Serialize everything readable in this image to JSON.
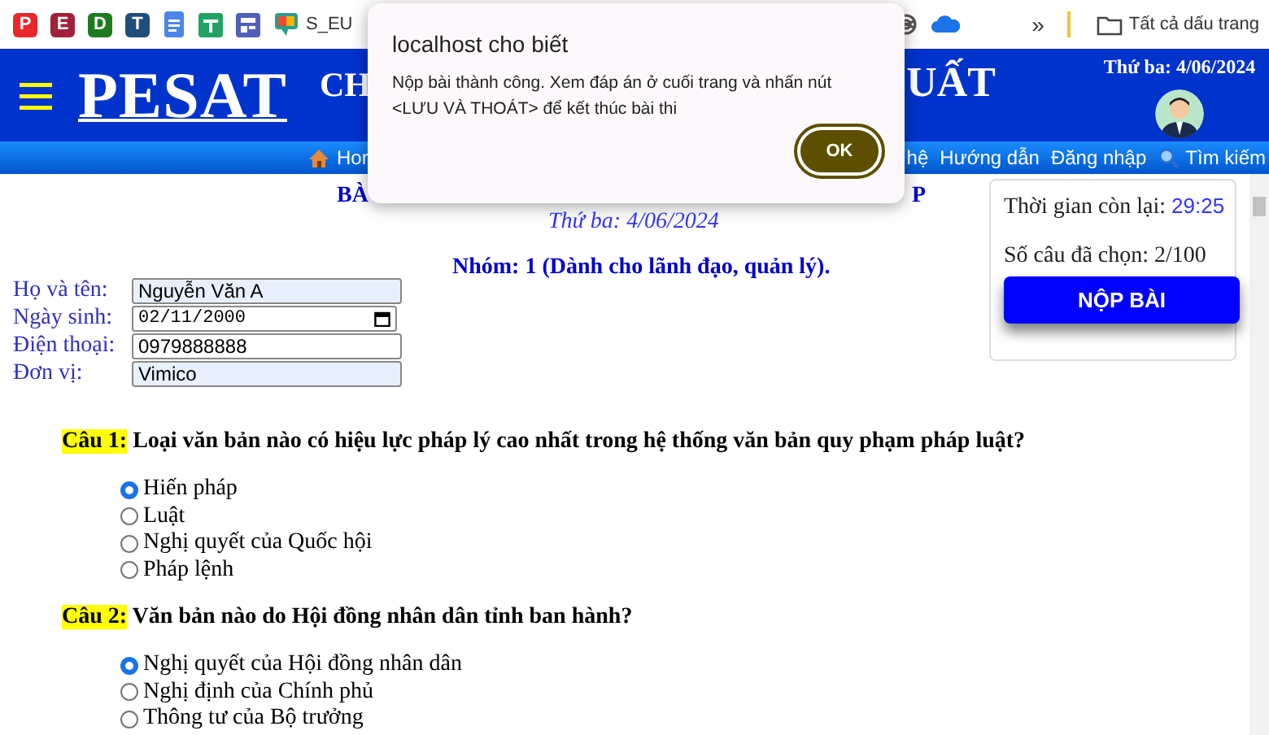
{
  "bookmarks_bar": {
    "items": [
      {
        "kind": "tile",
        "glyph": "P",
        "color": "#e8262b"
      },
      {
        "kind": "tile",
        "glyph": "E",
        "color": "#a3203a"
      },
      {
        "kind": "tile",
        "glyph": "D",
        "color": "#1e7b1e"
      },
      {
        "kind": "tile",
        "glyph": "T",
        "color": "#1f4e79"
      },
      {
        "kind": "doc",
        "color": "#4a86e8"
      },
      {
        "kind": "sheet",
        "color": "#21a366"
      },
      {
        "kind": "form",
        "color": "#5060b8"
      },
      {
        "kind": "chat",
        "color": "#2a9d8f",
        "label": "S_EU"
      }
    ],
    "right_items": [
      {
        "kind": "knot",
        "color": "#555555"
      },
      {
        "kind": "cloud",
        "color": "#1a73e8"
      }
    ],
    "overflow": "»",
    "all_bookmarks": "Tất cả dấu trang"
  },
  "header": {
    "logo": "PESAT",
    "title_fragments": [
      "CH",
      "UẤT"
    ],
    "date": "Thứ ba: 4/06/2024"
  },
  "nav": {
    "items": [
      {
        "label": "Hor",
        "kind": "home"
      },
      {
        "label": "hệ",
        "kind": "plain"
      },
      {
        "label": "Hướng dẫn",
        "kind": "plain"
      },
      {
        "label": "Đăng nhập",
        "kind": "plain"
      },
      {
        "label": "Tìm kiếm",
        "kind": "search"
      }
    ]
  },
  "exam": {
    "title_fragments": [
      "BÀ",
      "P"
    ],
    "date": "Thứ ba: 4/06/2024",
    "group": "Nhóm: 1 (Dành cho lãnh đạo, quản lý)."
  },
  "form": {
    "fields": [
      {
        "label": "Họ và tên:",
        "value": "Nguyễn Văn A",
        "kind": "text",
        "autofilled": true
      },
      {
        "label": "Ngày sinh:",
        "value": "02/11/2000",
        "kind": "date",
        "autofilled": false
      },
      {
        "label": "Điện thoại:",
        "value": "0979888888",
        "kind": "text",
        "autofilled": false
      },
      {
        "label": "Đơn vị:",
        "value": "Vimico",
        "kind": "text",
        "autofilled": true
      }
    ]
  },
  "questions": [
    {
      "number": "Câu 1:",
      "text": "Loại văn bản nào có hiệu lực pháp lý cao nhất trong hệ thống văn bản quy phạm pháp luật?",
      "options": [
        {
          "label": "Hiến pháp",
          "selected": true
        },
        {
          "label": "Luật",
          "selected": false
        },
        {
          "label": "Nghị quyết của Quốc hội",
          "selected": false
        },
        {
          "label": "Pháp lệnh",
          "selected": false
        }
      ]
    },
    {
      "number": "Câu 2:",
      "text": "Văn bản nào do Hội đồng nhân dân tỉnh ban hành?",
      "options": [
        {
          "label": "Nghị quyết của Hội đồng nhân dân",
          "selected": true
        },
        {
          "label": "Nghị định của Chính phủ",
          "selected": false
        },
        {
          "label": "Thông tư của Bộ trưởng",
          "selected": false
        }
      ]
    }
  ],
  "side_panel": {
    "time_label": "Thời gian còn lại:",
    "time": "29:25",
    "count": "Số câu đã chọn: 2/100",
    "submit": "NỘP BÀI"
  },
  "dialog": {
    "title": "localhost cho biết",
    "message": "Nộp bài thành công. Xem đáp án ở cuối trang và nhấn nút <LƯU VÀ THOÁT> để kết thúc bài thi",
    "button": "OK"
  }
}
